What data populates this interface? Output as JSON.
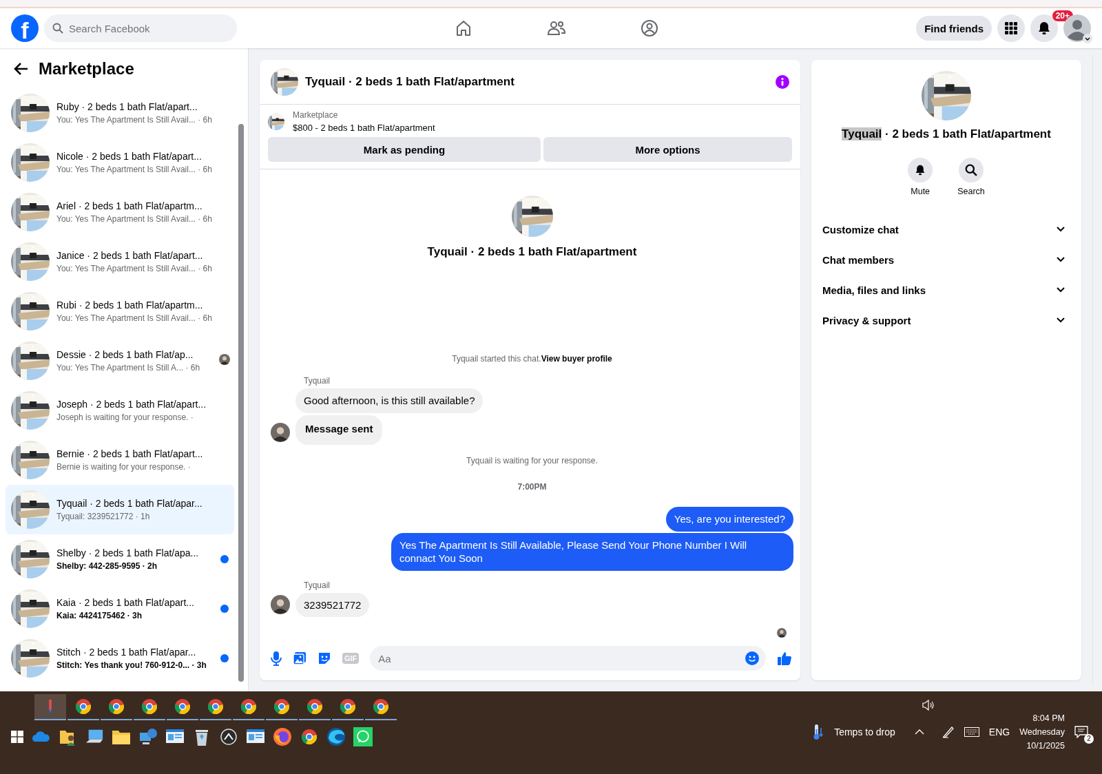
{
  "top_bar": {
    "logo_letter": "f",
    "search": {
      "placeholder": "Search Facebook"
    },
    "find_friends": "Find friends",
    "notification_count": "20+"
  },
  "sidebar": {
    "title": "Marketplace"
  },
  "conversations": [
    {
      "title": "Ruby · 2 beds 1 bath Flat/apart...",
      "meta": "You: Yes The Apartment Is Still Avail... · 6h",
      "unread": false,
      "selected": false,
      "seen": false
    },
    {
      "title": "Nicole · 2 beds 1 bath Flat/apart...",
      "meta": "You: Yes The Apartment Is Still Avail... · 6h",
      "unread": false,
      "selected": false,
      "seen": false
    },
    {
      "title": "Ariel · 2 beds 1 bath Flat/apartm...",
      "meta": "You: Yes The Apartment Is Still Avail... · 6h",
      "unread": false,
      "selected": false,
      "seen": false
    },
    {
      "title": "Janice · 2 beds 1 bath Flat/apart...",
      "meta": "You: Yes The Apartment Is Still Avail... · 6h",
      "unread": false,
      "selected": false,
      "seen": false
    },
    {
      "title": "Rubi · 2 beds 1 bath Flat/apartm...",
      "meta": "You: Yes The Apartment Is Still Avail... · 6h",
      "unread": false,
      "selected": false,
      "seen": false
    },
    {
      "title": "Dessie · 2 beds 1 bath Flat/ap...",
      "meta": "You: Yes The Apartment Is Still A... · 6h",
      "unread": false,
      "selected": false,
      "seen": true
    },
    {
      "title": "Joseph · 2 beds 1 bath Flat/apart...",
      "meta": "Joseph is waiting for your response. ·",
      "unread": false,
      "selected": false,
      "seen": false
    },
    {
      "title": "Bernie · 2 beds 1 bath Flat/apart...",
      "meta": "Bernie is waiting for your response. ·",
      "unread": false,
      "selected": false,
      "seen": false
    },
    {
      "title": "Tyquail · 2 beds 1 bath Flat/apar...",
      "meta": "Tyquail: 3239521772 · 1h",
      "unread": false,
      "selected": true,
      "seen": false
    },
    {
      "title": "Shelby · 2 beds 1 bath Flat/apa...",
      "meta": "Shelby: 442-285-9595 · 2h",
      "unread": true,
      "selected": false,
      "seen": false
    },
    {
      "title": "Kaia · 2 beds 1 bath Flat/apart...",
      "meta": "Kaia: 4424175462 · 3h",
      "unread": true,
      "selected": false,
      "seen": false
    },
    {
      "title": "Stitch · 2 beds 1 bath Flat/apar...",
      "meta": "Stitch: Yes thank you! 760-912-0... · 3h",
      "unread": true,
      "selected": false,
      "seen": false
    }
  ],
  "chat": {
    "title": "Tyquail · 2 beds 1 bath Flat/apartment",
    "listing": {
      "source": "Marketplace",
      "summary": "$800 - 2 beds 1 bath Flat/apartment"
    },
    "actions": [
      "Mark as pending",
      "More options"
    ],
    "intro_title": "Tyquail · 2 beds 1 bath Flat/apartment",
    "messages": [
      {
        "kind": "notice",
        "text": "Tyquail started this chat.",
        "link": "View buyer profile"
      },
      {
        "kind": "incoming",
        "sender": "Tyquail",
        "bubbles": [
          {
            "text": "Good afternoon, is this still available?",
            "bold": false
          },
          {
            "text": "Message sent",
            "bold": true
          }
        ]
      },
      {
        "kind": "notice",
        "text": "Tyquail is waiting for your response."
      },
      {
        "kind": "time",
        "text": "7:00PM"
      },
      {
        "kind": "outgoing",
        "bubbles": [
          {
            "text": "Yes, are you interested?",
            "bold": false
          },
          {
            "text": "Yes The Apartment Is Still Available, Please Send Your Phone Number I Will connact You Soon",
            "bold": false
          }
        ]
      },
      {
        "kind": "incoming",
        "sender": "Tyquail",
        "bubbles": [
          {
            "text": "3239521772",
            "bold": false
          }
        ]
      },
      {
        "kind": "seen"
      }
    ],
    "composer": {
      "gif_label": "GIF",
      "placeholder": "Aa"
    }
  },
  "details": {
    "title_highlight": "Tyquail",
    "title_rest": " · 2 beds 1 bath Flat/apartment",
    "actions": [
      {
        "kind": "mute",
        "label": "Mute"
      },
      {
        "kind": "search",
        "label": "Search"
      }
    ],
    "sections": [
      {
        "label": "Customize chat",
        "expanded": false
      },
      {
        "label": "Chat members",
        "expanded": false
      },
      {
        "label": "Media, files and links",
        "expanded": false
      },
      {
        "label": "Privacy & support",
        "expanded": false
      }
    ]
  },
  "taskbar": {
    "windows": [
      {
        "kind": "tool",
        "selected": true
      },
      {
        "kind": "browser",
        "selected": false
      },
      {
        "kind": "browser",
        "selected": false
      },
      {
        "kind": "browser",
        "selected": false
      },
      {
        "kind": "browser",
        "selected": false
      },
      {
        "kind": "browser",
        "selected": false
      },
      {
        "kind": "browser",
        "selected": false
      },
      {
        "kind": "browser",
        "selected": false
      },
      {
        "kind": "browser",
        "selected": false
      },
      {
        "kind": "browser",
        "selected": false
      },
      {
        "kind": "browser",
        "selected": false
      }
    ],
    "pinned": [
      {
        "kind": "cloud"
      },
      {
        "kind": "user-folder"
      },
      {
        "kind": "computer"
      },
      {
        "kind": "folder"
      },
      {
        "kind": "network"
      },
      {
        "kind": "panel"
      },
      {
        "kind": "bin"
      },
      {
        "kind": "dial"
      },
      {
        "kind": "panel"
      },
      {
        "kind": "fox"
      },
      {
        "kind": "browser"
      },
      {
        "kind": "wave"
      },
      {
        "kind": "chat"
      }
    ],
    "weather": "Temps to drop",
    "language": "ENG",
    "time": "8:04 PM",
    "day": "Wednesday",
    "date": "10/1/2025",
    "notifications": "2"
  }
}
